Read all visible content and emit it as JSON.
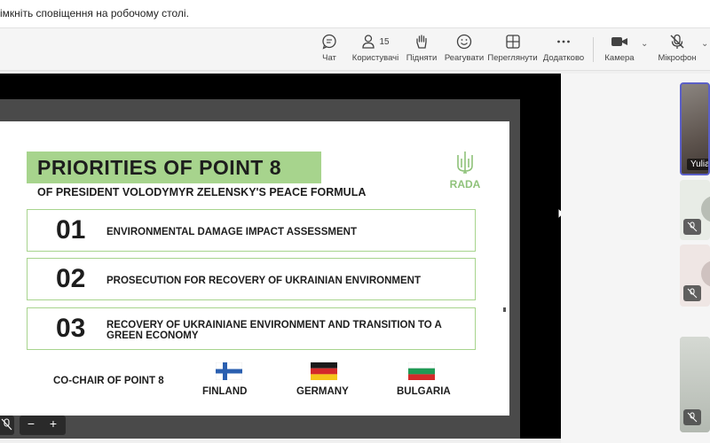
{
  "notification": {
    "text": "імкніть сповіщення на робочому столі."
  },
  "toolbar": {
    "chat_label": "Чат",
    "people_label": "Користувачі",
    "people_count": "15",
    "raise_label": "Підняти",
    "react_label": "Реагувати",
    "view_label": "Переглянути",
    "more_label": "Додатково",
    "camera_label": "Камера",
    "mic_label": "Мікрофон"
  },
  "slide": {
    "title": "PRIORITIES OF POINT 8",
    "subtitle": "OF PRESIDENT VOLODYMYR ZELENSKY'S PEACE FORMULA",
    "logo_text": "RADA",
    "items": [
      {
        "num": "01",
        "text": "ENVIRONMENTAL DAMAGE IMPACT ASSESSMENT"
      },
      {
        "num": "02",
        "text": "PROSECUTION FOR RECOVERY OF UKRAINIAN ENVIRONMENT"
      },
      {
        "num": "03",
        "text": "RECOVERY OF UKRAINIANE ENVIRONMENT AND TRANSITION TO A GREEN ECONOMY"
      }
    ],
    "cochair_label": "CO-CHAIR OF POINT 8",
    "countries": [
      "FINLAND",
      "GERMANY",
      "BULGARIA"
    ]
  },
  "zoom": {
    "minus": "−",
    "plus": "+"
  },
  "participants": [
    {
      "name": "Yulia"
    }
  ],
  "colors": {
    "accent_green": "#a7d48d",
    "logo_green": "#8fc27a",
    "toolbar_bg": "#f5f5f5",
    "stage_bg": "#000000"
  },
  "icons": [
    "chat-icon",
    "people-icon",
    "raise-hand-icon",
    "react-icon",
    "view-icon",
    "more-icon",
    "camera-icon",
    "mic-off-icon",
    "trident-icon",
    "zoom-minus-icon",
    "zoom-plus-icon"
  ]
}
